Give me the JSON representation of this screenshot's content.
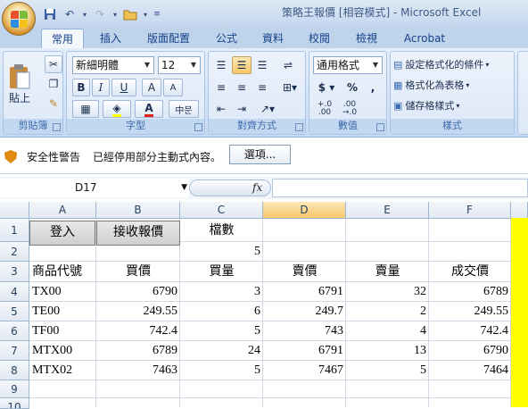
{
  "app": {
    "title": "策略王報價  [相容模式] - Microsoft Excel"
  },
  "tabs": [
    "常用",
    "插入",
    "版面配置",
    "公式",
    "資料",
    "校閱",
    "檢視",
    "Acrobat"
  ],
  "ribbon": {
    "clipboard": {
      "label": "剪貼簿",
      "paste": "貼上"
    },
    "font": {
      "label": "字型",
      "name": "新細明體",
      "size": "12",
      "bold": "B",
      "italic": "I",
      "underline": "U",
      "grow": "A",
      "shrink": "A"
    },
    "alignment": {
      "label": "對齊方式"
    },
    "number": {
      "label": "數值",
      "format": "通用格式",
      "currency": "$",
      "percent": "%",
      "comma": ",",
      "inc": "+.0\n.00",
      "dec": ".00\n→.0"
    },
    "styles": {
      "label": "樣式",
      "conditional": "設定格式化的條件",
      "table": "格式化為表格",
      "cell": "儲存格樣式"
    }
  },
  "security": {
    "title": "安全性警告",
    "message": "已經停用部分主動式內容。",
    "options": "選項..."
  },
  "formula_bar": {
    "name_box": "D17",
    "fx": "fx",
    "content": ""
  },
  "columns": [
    "A",
    "B",
    "C",
    "D",
    "E",
    "F"
  ],
  "rows": [
    "1",
    "2",
    "3",
    "4",
    "5",
    "6",
    "7",
    "8",
    "9",
    "10"
  ],
  "sheet": {
    "login_button": "登入",
    "receive_button": "接收報價",
    "c1": "檔數",
    "c2": "5",
    "headers": [
      "商品代號",
      "買價",
      "買量",
      "賣價",
      "賣量",
      "成交價"
    ],
    "data": [
      [
        "TX00",
        "6790",
        "3",
        "6791",
        "32",
        "6789"
      ],
      [
        "TE00",
        "249.55",
        "6",
        "249.7",
        "2",
        "249.55"
      ],
      [
        "TF00",
        "742.4",
        "5",
        "743",
        "4",
        "742.4"
      ],
      [
        "MTX00",
        "6789",
        "24",
        "6791",
        "13",
        "6790"
      ],
      [
        "MTX02",
        "7463",
        "5",
        "7467",
        "5",
        "7464"
      ]
    ]
  },
  "colors": {
    "accent_yellow": "#ffff00",
    "selected_column": "#f8c76b"
  }
}
